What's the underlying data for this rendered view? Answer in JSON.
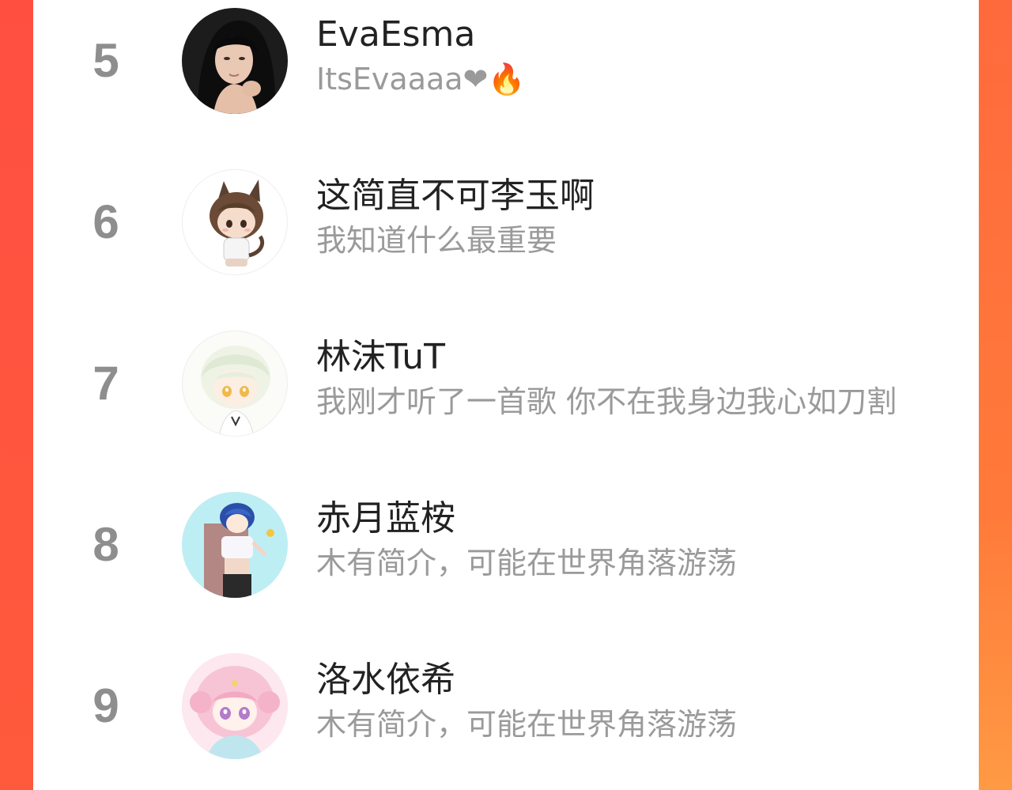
{
  "users": [
    {
      "rank": "5",
      "name": "EvaEsma",
      "bio": "ItsEvaaaa❤🔥",
      "avatar": "avatar-photo-girl"
    },
    {
      "rank": "6",
      "name": "这简直不可李玉啊",
      "bio": "我知道什么最重要",
      "avatar": "avatar-chibi-cat-boy"
    },
    {
      "rank": "7",
      "name": "林沫TuT",
      "bio": "我刚才听了一首歌 你不在我身边我心如刀割",
      "avatar": "avatar-anime-white-hair"
    },
    {
      "rank": "8",
      "name": "赤月蓝桉",
      "bio": "木有简介，可能在世界角落游荡",
      "avatar": "avatar-anime-blue-hair"
    },
    {
      "rank": "9",
      "name": "洛水依希",
      "bio": "木有简介，可能在世界角落游荡",
      "avatar": "avatar-anime-pink-hair"
    }
  ],
  "colors": {
    "accent_left": "#ff4f41",
    "accent_right": "#ff7a3a",
    "rank": "#8e8e8e",
    "name": "#222222",
    "bio": "#9a9a9a"
  }
}
